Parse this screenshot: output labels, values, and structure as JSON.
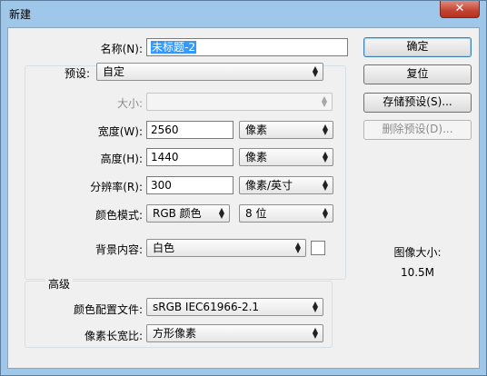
{
  "window": {
    "title": "新建",
    "close_glyph": "✕"
  },
  "form": {
    "name": {
      "label": "名称(N):",
      "value": "未标题-2"
    },
    "preset": {
      "label": "预设:",
      "value": "自定"
    },
    "size": {
      "label": "大小:",
      "value": ""
    },
    "width": {
      "label": "宽度(W):",
      "value": "2560",
      "unit": "像素"
    },
    "height": {
      "label": "高度(H):",
      "value": "1440",
      "unit": "像素"
    },
    "resolution": {
      "label": "分辨率(R):",
      "value": "300",
      "unit": "像素/英寸"
    },
    "color_mode": {
      "label": "颜色模式:",
      "mode": "RGB 颜色",
      "depth": "8 位"
    },
    "background": {
      "label": "背景内容:",
      "value": "白色"
    },
    "advanced": {
      "title": "高级",
      "color_profile": {
        "label": "颜色配置文件:",
        "value": "sRGB IEC61966-2.1"
      },
      "pixel_aspect": {
        "label": "像素长宽比:",
        "value": "方形像素"
      }
    }
  },
  "buttons": {
    "ok": "确定",
    "reset": "复位",
    "save_preset": "存储预设(S)...",
    "delete_preset": "删除预设(D)..."
  },
  "info": {
    "image_size_label": "图像大小:",
    "image_size_value": "10.5M"
  },
  "icons": {
    "dropdown": "updown-arrows-icon"
  }
}
